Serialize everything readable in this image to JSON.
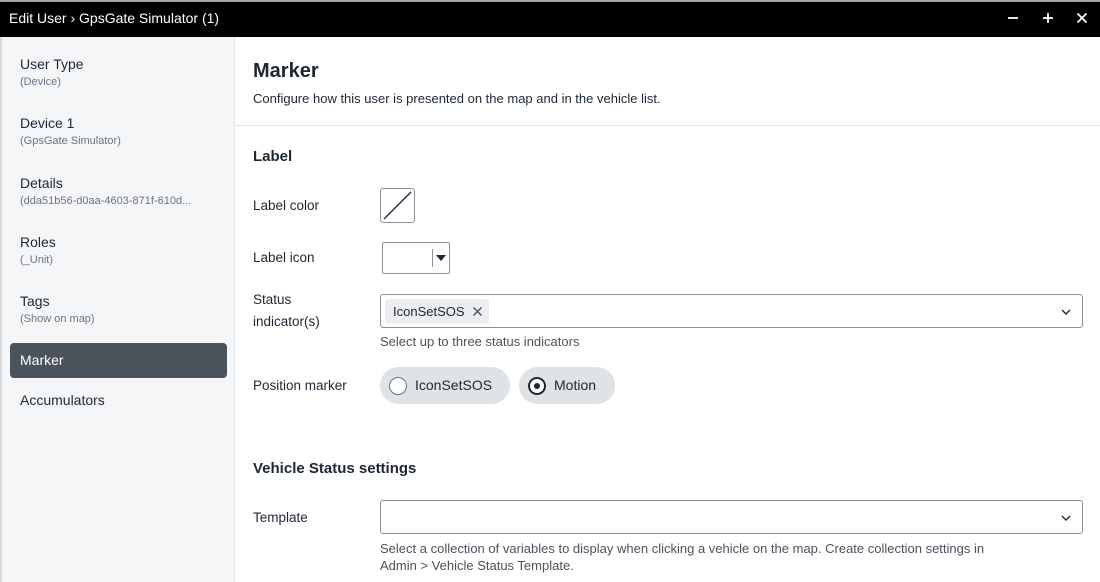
{
  "window": {
    "title": "Edit User › GpsGate Simulator (1)",
    "controls": [
      "minimize-icon",
      "maximize-icon",
      "close-icon"
    ]
  },
  "sidebar": {
    "items": [
      {
        "label": "User Type",
        "sub": "(Device)"
      },
      {
        "label": "Device 1",
        "sub": "(GpsGate Simulator)"
      },
      {
        "label": "Details",
        "sub": "(dda51b56-d0aa-4603-871f-610d..."
      },
      {
        "label": "Roles",
        "sub": "(_Unit)"
      },
      {
        "label": "Tags",
        "sub": "(Show on map)"
      },
      {
        "label": "Marker",
        "sub": "",
        "active": true
      },
      {
        "label": "Accumulators",
        "sub": ""
      }
    ]
  },
  "main": {
    "title": "Marker",
    "description": "Configure how this user is presented on the map and in the vehicle list.",
    "label_section": {
      "title": "Label",
      "label_color": "Label color",
      "label_icon": "Label icon",
      "status_indicators_line1": "Status",
      "status_indicators_line2": "indicator(s)",
      "status_chip": "IconSetSOS",
      "status_helper": "Select up to three status indicators",
      "position_marker": "Position marker",
      "position_options": [
        {
          "label": "IconSetSOS",
          "checked": false
        },
        {
          "label": "Motion",
          "checked": true
        }
      ]
    },
    "vehicle_section": {
      "title": "Vehicle Status settings",
      "template_label": "Template",
      "template_value": "",
      "template_helper_line1": "Select a collection of variables to display when clicking a vehicle on the map. Create collection settings in",
      "template_helper_line2": "Admin > Vehicle Status Template."
    }
  },
  "colors": {
    "titlebar_bg": "#000000",
    "sidebar_bg": "#f5f6f8",
    "active_nav_bg": "#4a525c",
    "pill_bg": "#dfe3e8",
    "text": "#1d2733"
  }
}
